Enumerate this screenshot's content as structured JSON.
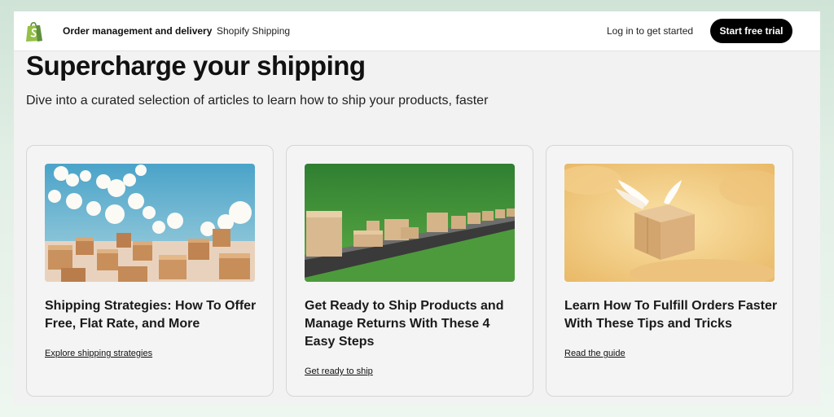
{
  "header": {
    "logo_icon": "shopify-bag-icon",
    "nav": [
      {
        "label": "Order management and delivery"
      },
      {
        "label": "Shopify Shipping"
      }
    ],
    "login_label": "Log in to get started",
    "cta_label": "Start free trial"
  },
  "hero": {
    "title": "Supercharge your shipping",
    "subtitle": "Dive into a curated selection of articles to learn how to ship your products, faster"
  },
  "cards": [
    {
      "image": "boxes-clouds-illustration",
      "title": "Shipping Strategies: How To Offer Free, Flat Rate, and More",
      "link": "Explore shipping strategies"
    },
    {
      "image": "conveyor-belt-boxes-illustration",
      "title": "Get Ready to Ship Products and Manage Returns With These 4 Easy Steps",
      "link": "Get ready to ship"
    },
    {
      "image": "winged-box-illustration",
      "title": "Learn How To Fulfill Orders Faster With These Tips and Tricks",
      "link": "Read the guide"
    }
  ],
  "colors": {
    "cta_background": "#000000",
    "page_background": "#f2f2f2",
    "logo_green": "#95bf47"
  }
}
